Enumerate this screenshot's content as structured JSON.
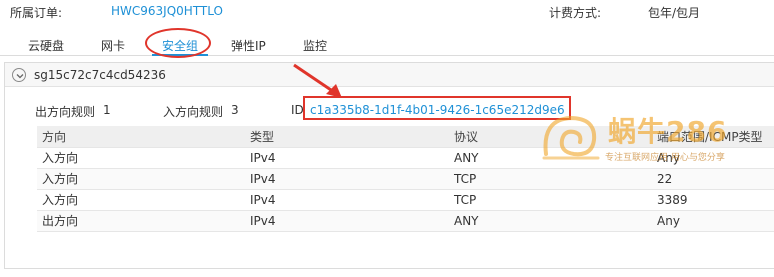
{
  "header": {
    "order_label": "所属订单:",
    "order_value": "HWC963JQ0HTTLO",
    "billing_label": "计费方式:",
    "billing_value": "包年/包月"
  },
  "tabs": [
    {
      "label": "云硬盘",
      "active": false
    },
    {
      "label": "网卡",
      "active": false
    },
    {
      "label": "安全组",
      "active": true
    },
    {
      "label": "弹性IP",
      "active": false
    },
    {
      "label": "监控",
      "active": false
    }
  ],
  "security_group": {
    "name": "sg15c72c7c4cd54236",
    "outbound_label": "出方向规则",
    "outbound_count": "1",
    "inbound_label": "入方向规则",
    "inbound_count": "3",
    "id_label": "ID",
    "id_value": "c1a335b8-1d1f-4b01-9426-1c65e212d9e6"
  },
  "rules_table": {
    "columns": [
      "方向",
      "类型",
      "协议",
      "端口范围/ICMP类型"
    ],
    "rows": [
      [
        "入方向",
        "IPv4",
        "ANY",
        "Any"
      ],
      [
        "入方向",
        "IPv4",
        "TCP",
        "22"
      ],
      [
        "入方向",
        "IPv4",
        "TCP",
        "3389"
      ],
      [
        "出方向",
        "IPv4",
        "ANY",
        "Any"
      ]
    ]
  },
  "watermark": {
    "title": "蜗牛286",
    "subtitle": "专注互联网应用 用心与您分享"
  },
  "colors": {
    "link": "#1e90d6",
    "annotation": "#e0352b",
    "watermark": "#f0a528"
  },
  "icons": [
    "chevron-down-icon",
    "annotation-arrow-icon",
    "snail-logo-icon"
  ]
}
